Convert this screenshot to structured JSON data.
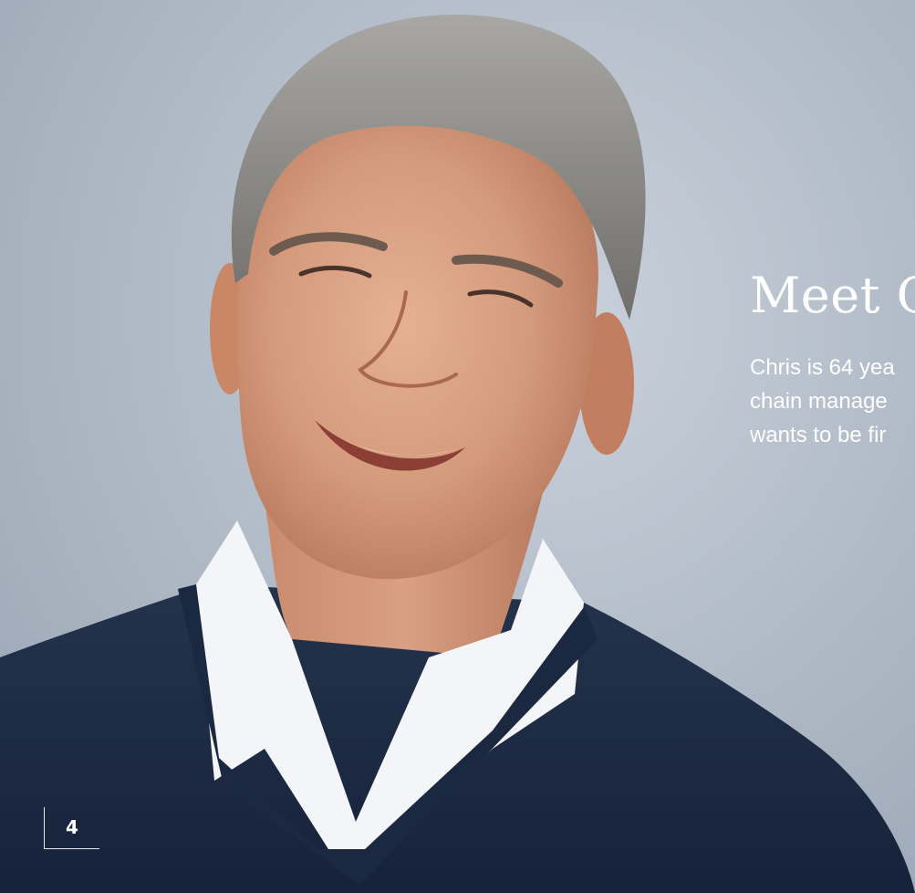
{
  "headline": "Meet C",
  "intro_lines": [
    "Chris is 64 yea",
    "chain manage",
    "wants to be fir"
  ],
  "page_number": "4",
  "colors": {
    "background": "#b3bdc9",
    "sweater": "#1c2c44",
    "shirt": "#f4f6f9",
    "skin": "#d99e80",
    "hair": "#8f8f8d",
    "text": "#ffffff"
  },
  "image": {
    "subject": "smiling grey-haired man in navy V-neck sweater over white collared shirt"
  }
}
